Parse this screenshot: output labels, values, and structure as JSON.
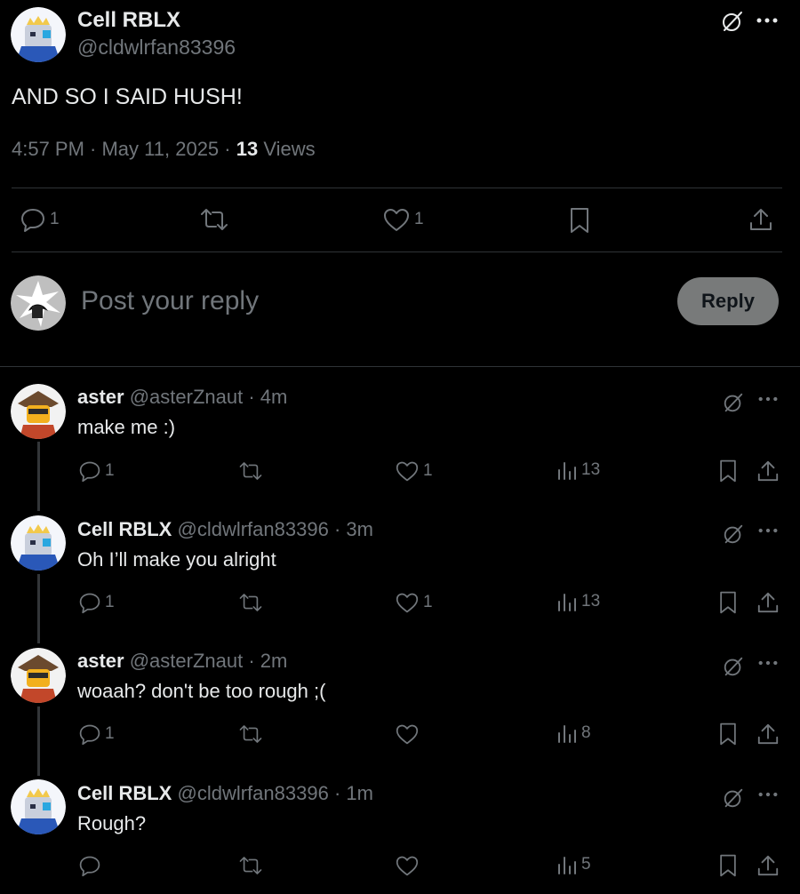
{
  "main_post": {
    "author_name": "Cell RBLX",
    "author_handle": "@cldwlrfan83396",
    "text": "AND SO I SAID HUSH!",
    "time": "4:57 PM · May 11, 2025 · ",
    "views_count": "13",
    "views_label": " Views",
    "actions": {
      "replies": "1",
      "likes": "1"
    }
  },
  "reply_box": {
    "placeholder": "Post your reply",
    "button_label": "Reply"
  },
  "replies": [
    {
      "name": "aster",
      "handle": "@asterZnaut",
      "time": "· 4m",
      "text": "make me :)",
      "replies": "1",
      "likes": "1",
      "views": "13"
    },
    {
      "name": "Cell RBLX",
      "handle": "@cldwlrfan83396",
      "time": "· 3m",
      "text": "Oh I’ll make you alright",
      "replies": "1",
      "likes": "1",
      "views": "13"
    },
    {
      "name": "aster",
      "handle": "@asterZnaut",
      "time": "· 2m",
      "text": "woaah? don't be too rough ;(",
      "replies": "1",
      "likes": "",
      "views": "8"
    },
    {
      "name": "Cell RBLX",
      "handle": "@cldwlrfan83396",
      "time": "· 1m",
      "text": "Rough?",
      "replies": "",
      "likes": "",
      "views": "5"
    }
  ],
  "icons": [
    "grok-icon",
    "more-icon",
    "reply-icon",
    "repost-icon",
    "like-icon",
    "bookmark-icon",
    "share-icon",
    "views-icon"
  ],
  "colors": {
    "background": "#000000",
    "text": "#e7e9ea",
    "muted": "#71767b",
    "divider": "#2f3336",
    "reply_button": "#787a7a"
  }
}
